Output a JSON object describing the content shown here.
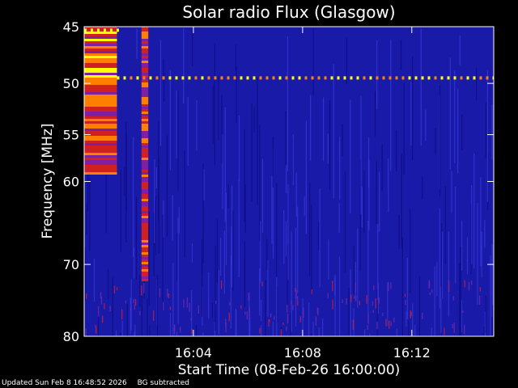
{
  "chart_data": {
    "type": "heatmap",
    "title": "Solar radio Flux (Glasgow)",
    "xlabel": "Start Time (08-Feb-26 16:00:00)",
    "ylabel": "Frequency [MHz]",
    "x_range_minutes": [
      0,
      15
    ],
    "x_ticks": [
      {
        "minute": 4,
        "label": "16:04"
      },
      {
        "minute": 8,
        "label": "16:08"
      },
      {
        "minute": 12,
        "label": "16:12"
      }
    ],
    "y_range_mhz": [
      45,
      80
    ],
    "y_scale": "log",
    "y_ticks": [
      {
        "value": 45,
        "label": "45"
      },
      {
        "value": 50,
        "label": "50"
      },
      {
        "value": 55,
        "label": "55"
      },
      {
        "value": 60,
        "label": "60"
      },
      {
        "value": 70,
        "label": "70"
      },
      {
        "value": 80,
        "label": "80"
      }
    ],
    "colormap": [
      "#000080",
      "#1020c0",
      "#3030e0",
      "#8020a0",
      "#d02020",
      "#ff8000",
      "#ffff00",
      "#ffffff"
    ],
    "background_color": "#1a1aa8",
    "features": [
      {
        "kind": "emission-band",
        "minute_start": 0.0,
        "minute_end": 1.2,
        "mhz_start": 45,
        "mhz_end": 59,
        "intensity": 0.9
      },
      {
        "kind": "emission-band",
        "minute_start": 2.1,
        "minute_end": 2.35,
        "mhz_start": 45,
        "mhz_end": 72,
        "intensity": 0.8
      },
      {
        "kind": "interference-line",
        "mhz": 49.5,
        "minute_start": 1.2,
        "minute_end": 15,
        "intensity": 0.75
      },
      {
        "kind": "interference-line",
        "mhz": 45.3,
        "minute_start": 0,
        "minute_end": 1.2,
        "intensity": 0.85
      },
      {
        "kind": "noise-band",
        "mhz_start": 72,
        "mhz_end": 80,
        "intensity": 0.3
      }
    ]
  },
  "footer": {
    "updated": "Updated Sun Feb  8 16:48:52 2026",
    "note": "BG subtracted"
  }
}
